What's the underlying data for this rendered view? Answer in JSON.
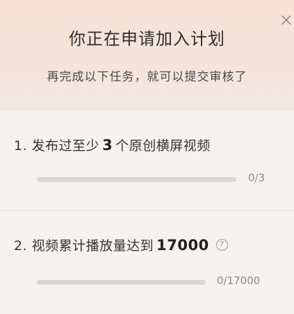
{
  "dialog": {
    "close_label": "×",
    "title": "你正在申请加入计划",
    "subtitle": "再完成以下任务，就可以提交审核了"
  },
  "tasks": [
    {
      "prefix": "1. 发布过至少",
      "value": "3",
      "suffix": "个原创横屏视频",
      "progress_text": "0/3",
      "progress_fraction": 0
    },
    {
      "prefix": "2. 视频累计播放量达到",
      "value": "17000",
      "suffix": "",
      "help_icon": "?",
      "progress_text": "0/17000",
      "progress_fraction": 0
    }
  ],
  "colors": {
    "header_bg": "#f7e2d6",
    "body_bg": "#f6f2ef",
    "track": "#dcd6d1",
    "fill": "#e86a4a"
  }
}
